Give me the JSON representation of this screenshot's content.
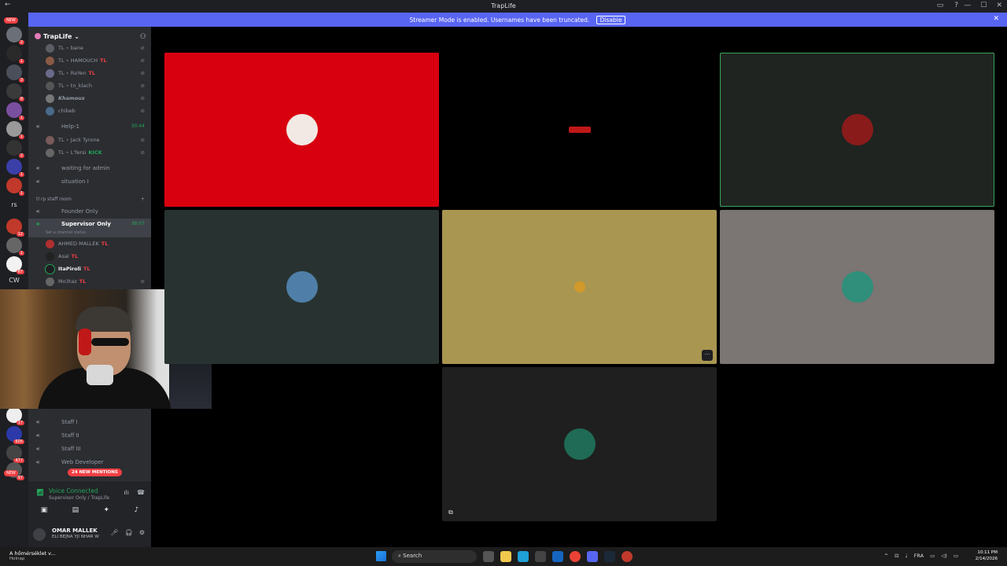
{
  "window": {
    "title": "TrapLife"
  },
  "banner": {
    "message": "Streamer Mode is enabled. Usernames have been truncated.",
    "disable_label": "Disable"
  },
  "servers": {
    "new_label": "NEW",
    "badges": [
      "2",
      "1",
      "3",
      "8",
      "1",
      "1",
      "2",
      "1",
      "1",
      "12",
      "1",
      "67",
      "17",
      "605",
      "477",
      "97"
    ],
    "text_items": [
      "rs",
      "CW"
    ]
  },
  "sidebar": {
    "server_name": "TrapLife",
    "channels": [
      {
        "label": "Help-1",
        "time": "30:44",
        "active": false
      },
      {
        "label": "waiting for admin",
        "time": "",
        "active": false
      },
      {
        "label": "situation I",
        "time": "",
        "active": false
      },
      {
        "label": "Founder Only",
        "time": "",
        "active": false
      },
      {
        "label": "Supervisor Only",
        "time": "38:07",
        "active": true
      },
      {
        "label": "Staff I",
        "time": "",
        "active": false
      },
      {
        "label": "Staff II",
        "time": "",
        "active": false
      },
      {
        "label": "Staff III",
        "time": "",
        "active": false
      },
      {
        "label": "Web Developer",
        "time": "",
        "active": false
      }
    ],
    "category": "tl rp staff room",
    "channel_status_hint": "Set a channel status",
    "users_top": [
      {
        "name": "TL ⋆ bane",
        "tag": ""
      },
      {
        "name": "TL ⋆ HAMOUCH",
        "tag": "TL"
      },
      {
        "name": "TL ⋆ RaYen",
        "tag": "TL"
      },
      {
        "name": "TL ⋆ tn_klach",
        "tag": ""
      },
      {
        "name": "Khamous",
        "tag": ""
      },
      {
        "name": "chibeb",
        "tag": ""
      }
    ],
    "users_help": [
      {
        "name": "TL ⋆ Jack Tyrone",
        "tag": ""
      },
      {
        "name": "TL ⋆ L'fersi",
        "tag": "KICK"
      }
    ],
    "users_supervisor": [
      {
        "name": "AHMED MALLEK",
        "tag": "TL"
      },
      {
        "name": "Asal",
        "tag": "TL"
      },
      {
        "name": "ItaPiroli",
        "tag": "TL"
      },
      {
        "name": "Mo3taz",
        "tag": "TL"
      }
    ],
    "mentions_label": "24 NEW MENTIONS"
  },
  "voice": {
    "status": "Voice Connected",
    "channel": "Supervisor Only / TrapLife"
  },
  "user_panel": {
    "username": "OMAR MALLEK",
    "status": "ELI BEJNA YJI NHAR W"
  },
  "stage": {
    "tiles": [
      {
        "bg": "#d8000f",
        "avatar": "#f2e9e4",
        "speaking": false
      },
      {
        "bg": "#000000",
        "avatar": "#c01818",
        "speaking": false
      },
      {
        "bg": "#1f2420",
        "avatar": "#8a1b1b",
        "speaking": true
      },
      {
        "bg": "#283331",
        "avatar": "#4f7fa8",
        "speaking": false
      },
      {
        "bg": "#a99650",
        "avatar": "#d19a2a",
        "speaking": false
      },
      {
        "bg": "#7b7573",
        "avatar": "#2f8f7a",
        "speaking": false
      },
      {
        "bg": "#1f1f1f",
        "avatar": "#1f6b55",
        "speaking": false
      }
    ],
    "more_label": "···"
  },
  "taskbar": {
    "weather_line1": "A hőmérséklet v...",
    "weather_line2": "Holnap",
    "search": "Search",
    "lang": "FRA",
    "time": "10:11 PM",
    "date": "2/14/2026"
  },
  "colors": {
    "accent": "#5865f2",
    "connected": "#23a55a",
    "alert": "#f23f43"
  }
}
